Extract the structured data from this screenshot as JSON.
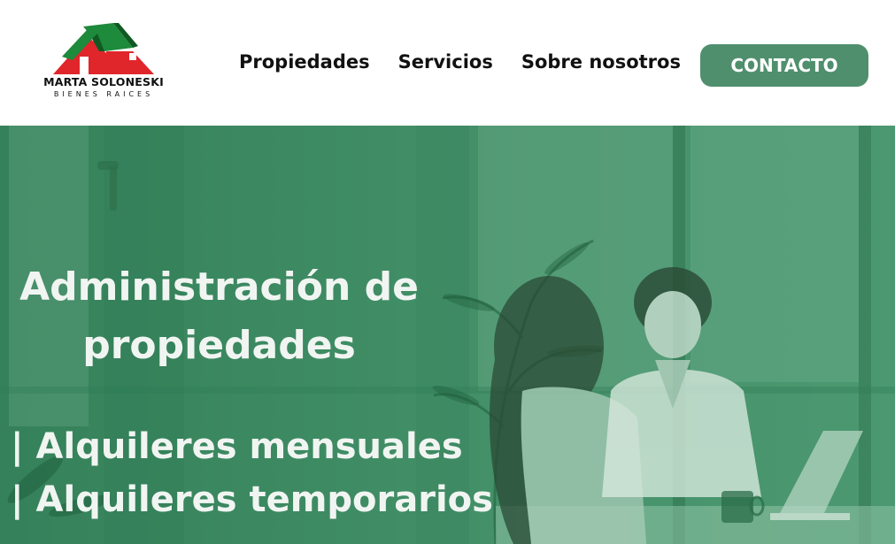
{
  "logo": {
    "name": "MARTA SOLONESKI",
    "subtitle": "BIENES RAICES"
  },
  "nav": {
    "items": [
      "Propiedades",
      "Servicios",
      "Sobre nosotros"
    ]
  },
  "header": {
    "contact_label": "CONTACTO"
  },
  "hero": {
    "title_line1": "Administración de",
    "title_line2": "propiedades",
    "services": [
      "| Alquileres mensuales",
      "| Alquileres temporarios"
    ]
  },
  "colors": {
    "accent": "#4f8f6d",
    "hero_overlay": "#3d8a62",
    "logo_red": "#e0262b",
    "logo_green": "#1e8a3c"
  }
}
